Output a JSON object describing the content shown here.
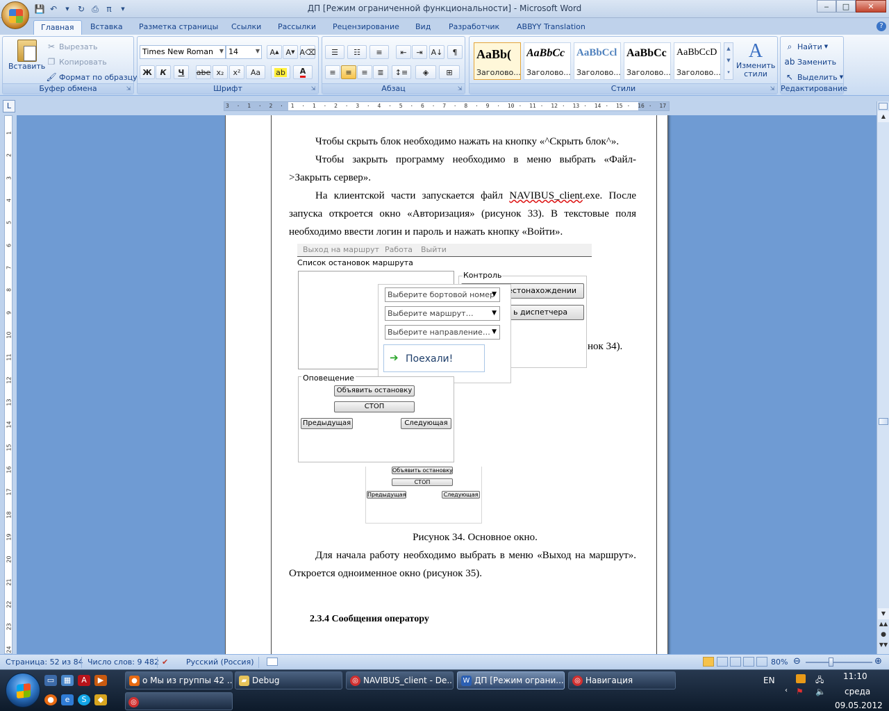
{
  "window": {
    "title": "ДП [Режим ограниченной функциональности] - Microsoft Word",
    "controls": {
      "minimize": "‒",
      "maximize": "□",
      "close": "✕"
    }
  },
  "qat": {
    "icons": [
      "save-icon",
      "undo-icon",
      "redo-icon",
      "print-icon",
      "pi-icon"
    ]
  },
  "tabs": [
    "Главная",
    "Вставка",
    "Разметка страницы",
    "Ссылки",
    "Рассылки",
    "Рецензирование",
    "Вид",
    "Разработчик",
    "ABBYY Translation"
  ],
  "ribbon": {
    "clipboard": {
      "label": "Буфер обмена",
      "paste": "Вставить",
      "cut": "Вырезать",
      "copy": "Копировать",
      "format_painter": "Формат по образцу"
    },
    "font": {
      "label": "Шрифт",
      "name": "Times New Roman",
      "size": "14",
      "bold": "Ж",
      "italic": "К",
      "underline": "Ч",
      "strike": "abe",
      "subscript": "x₂",
      "superscript": "x²",
      "case": "Aa"
    },
    "paragraph": {
      "label": "Абзац"
    },
    "styles": {
      "label": "Стили",
      "items": [
        {
          "sample": "AaBb(",
          "name": "Заголово..."
        },
        {
          "sample": "AaBbCc",
          "name": "Заголово..."
        },
        {
          "sample": "AaBbCcl",
          "name": "Заголово..."
        },
        {
          "sample": "AaBbCc",
          "name": "Заголово..."
        },
        {
          "sample": "AaBbCcD",
          "name": "Заголово..."
        }
      ],
      "change": "Изменить стили"
    },
    "editing": {
      "label": "Редактирование",
      "find": "Найти",
      "replace": "Заменить",
      "select": "Выделить"
    }
  },
  "ruler": {
    "h_ticks": [
      "3",
      "·",
      "1",
      "·",
      "2",
      "·",
      "1",
      "·",
      "1",
      "·",
      "2",
      "·",
      "3",
      "·",
      "4",
      "·",
      "5",
      "·",
      "6",
      "·",
      "7",
      "·",
      "8",
      "·",
      "9",
      "·",
      "10",
      "·",
      "11",
      "·",
      "12",
      "·",
      "13",
      "·",
      "14",
      "·",
      "15",
      "·",
      "16",
      "·",
      "17"
    ],
    "v_ticks": [
      "1",
      "2",
      "3",
      "4",
      "5",
      "6",
      "7",
      "8",
      "9",
      "10",
      "11",
      "12",
      "13",
      "14",
      "15",
      "16",
      "17",
      "18",
      "19",
      "20",
      "21",
      "22",
      "23",
      "24"
    ]
  },
  "document": {
    "p1": "Чтобы скрыть блок необходимо нажать на кнопку «^Скрыть блок^».",
    "p2": "Чтобы закрыть программу необходимо в меню выбрать «Файл->Закрыть сервер».",
    "p3_a": "На клиентской части запускается файл ",
    "p3_file": "NAVIBUS_client",
    "p3_b": ".exe. После запуска откроется окно «Авторизация» (рисунок 33). В текстовые поля необходимо ввести логин и пароль и нажать кнопку «Войти».",
    "caption": "Рисунок 34. Основное окно.",
    "p4": "Для начала работу необходимо выбрать в меню «Выход на маршрут». Откроется одноименное окно (рисунок 35).",
    "heading": "2.3.4 Сообщения оператору",
    "behind_text": "нок 34)."
  },
  "screenshot": {
    "menu": [
      "Выход на маршрут",
      "Работа",
      "Выйти"
    ],
    "stops_label": "Список остановок маршрута",
    "control_label": "Контроль",
    "btn_location": "местонахождении",
    "btn_dispatcher": "ь диспетчера",
    "combo_board": "Выберите бортовой  номер",
    "combo_route": "Выберите маршрут…",
    "combo_direction": "Выберите направление…",
    "go_button": "Поехали!",
    "notify_label": "Оповещение",
    "announce": "Объявить остановку",
    "stop": "СТОП",
    "prev": "Предыдущая",
    "next": "Следующая"
  },
  "status": {
    "page": "Страница: 52 из 84",
    "words": "Число слов: 9 482",
    "language": "Русский (Россия)",
    "zoom": "80%"
  },
  "taskbar": {
    "tasks": [
      {
        "label": "о Мы из группы 42 ...",
        "icon": "firefox-icon"
      },
      {
        "label": "Debug",
        "icon": "folder-icon"
      },
      {
        "label": "NAVIBUS_client - De...",
        "icon": "app-icon"
      },
      {
        "label": "ДП [Режим ограни...",
        "icon": "word-icon"
      },
      {
        "label": "Навигация",
        "icon": "app-icon"
      }
    ],
    "lang": "EN",
    "time": "11:10",
    "day": "среда",
    "date": "09.05.2012"
  },
  "colors": {
    "ribbon": "#dbe7f6",
    "workspace": "#6f9bd3",
    "taskbar": "#0d1a2a",
    "go_arrow": "#2aa52a"
  }
}
